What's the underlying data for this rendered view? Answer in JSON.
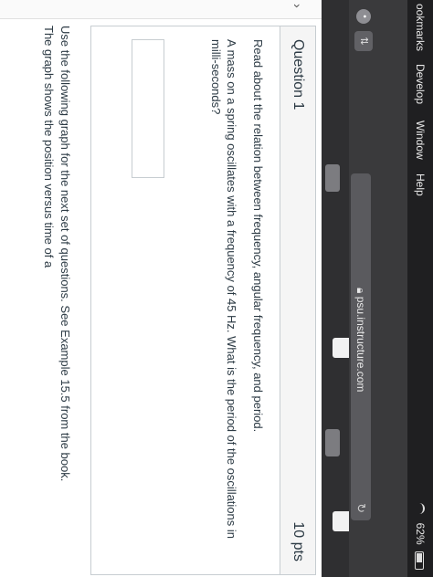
{
  "menubar": {
    "items": [
      "ookmarks",
      "Develop",
      "Window",
      "Help"
    ],
    "battery": "62%"
  },
  "browser": {
    "url": "psu.instructure.com",
    "sidebar_glyph": "⇅"
  },
  "question": {
    "title": "Question 1",
    "points": "10 pts",
    "paragraphs": [
      "Read about the relation between frequency, angular frequency, and period.",
      "A mass on a spring oscillates with a frequency of 45 Hz.  What is the period of the oscillations in milli-seconds?"
    ],
    "answer_value": ""
  },
  "next_section": {
    "line1": "Use the following graph for the next set of questions.  See Example 15.5 from the book.",
    "line2": "The graph shows the position versus time of a"
  },
  "icons": [
    "wifi-icon",
    "battery-icon",
    "lock-icon",
    "reload-icon",
    "chevron-right-icon"
  ]
}
